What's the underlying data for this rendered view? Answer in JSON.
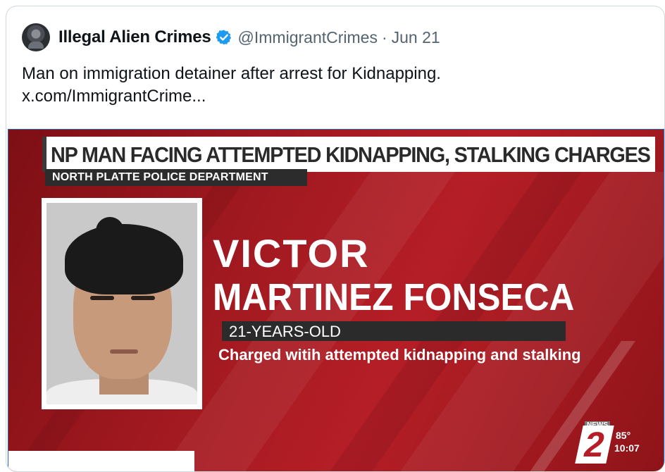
{
  "tweet": {
    "author_name": "Illegal Alien Crimes",
    "handle": "@ImmigrantCrimes",
    "separator": "·",
    "date": "Jun 21",
    "text_line1": "Man on immigration detainer after arrest for Kidnapping.",
    "link": "x.com/ImmigrantCrime..."
  },
  "media": {
    "headline": "NP MAN FACING ATTEMPTED KIDNAPPING, STALKING CHARGES",
    "department": "NORTH PLATTE POLICE DEPARTMENT",
    "first_name": "VICTOR",
    "last_name": "MARTINEZ FONSECA",
    "age": "21-YEARS-OLD",
    "charge": "Charged witih attempted kidnapping and stalking",
    "station": {
      "news_label": "NEWS",
      "channel": "2",
      "temperature": "85°",
      "time": "10:07"
    }
  },
  "colors": {
    "verified_blue": "#1d9bf0",
    "broadcast_red": "#a11920",
    "text_primary": "#0f1419",
    "text_secondary": "#536471"
  }
}
